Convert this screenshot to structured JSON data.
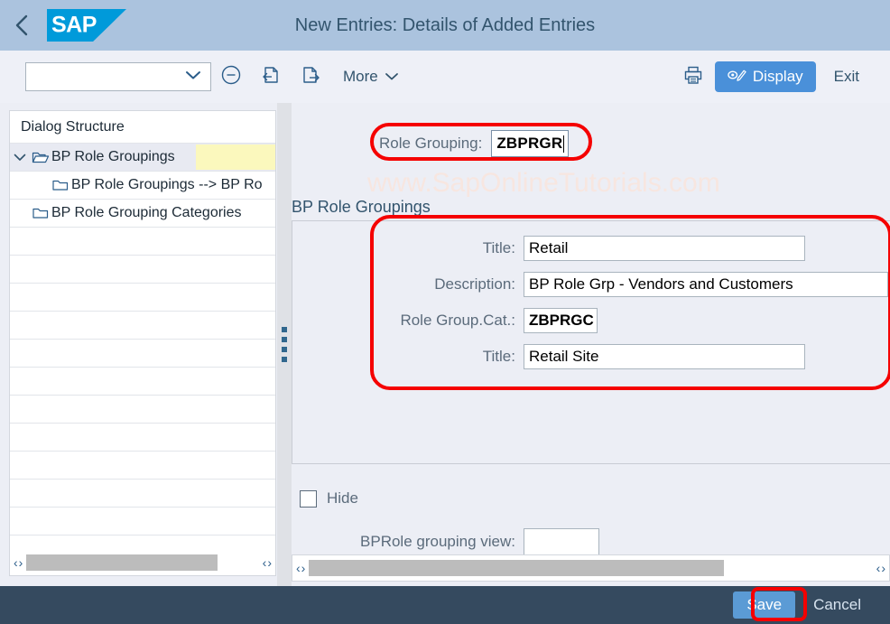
{
  "header": {
    "title": "New Entries: Details of Added Entries",
    "back_icon": "chevron-left-icon",
    "logo_text": "SAP"
  },
  "toolbar": {
    "select_value": "",
    "select_icon": "chevron-down-icon",
    "delete_icon": "minus-circle-icon",
    "prev_entry_icon": "previous-entry-icon",
    "next_entry_icon": "next-entry-icon",
    "more_label": "More",
    "more_icon": "chevron-down-icon",
    "print_icon": "printer-icon",
    "display_label": "Display",
    "display_icon": "display-change-icon",
    "exit_label": "Exit"
  },
  "sidebar": {
    "header": "Dialog Structure",
    "items": [
      {
        "label": "BP Role Groupings",
        "icon": "open-folder-icon",
        "expanded": true,
        "level": 0,
        "selected": true
      },
      {
        "label": "BP Role Groupings --> BP Ro",
        "icon": "folder-icon",
        "expanded": false,
        "level": 1,
        "selected": false
      },
      {
        "label": "BP Role Grouping Categories",
        "icon": "folder-icon",
        "expanded": false,
        "level": 0,
        "selected": false
      }
    ],
    "empty_row_count": 12,
    "scroll": {
      "left_arrow": "‹",
      "right_arrow": "›"
    }
  },
  "content": {
    "watermark": "www.SapOnlineTutorials.com",
    "role_grouping": {
      "label": "Role Grouping:",
      "value": "ZBPRGR",
      "focused": true
    },
    "section_title": "BP Role Groupings",
    "fields": [
      {
        "label": "Title:",
        "value": "Retail",
        "name": "title-field",
        "bold": false
      },
      {
        "label": "Description:",
        "value": "BP Role Grp - Vendors and Customers",
        "name": "description-field",
        "bold": false
      },
      {
        "label": "Role Group.Cat.:",
        "value": "ZBPRGC",
        "name": "role-group-cat-field",
        "bold": true
      },
      {
        "label": "Title:",
        "value": "Retail Site",
        "name": "category-title-field",
        "bold": false
      }
    ],
    "hide": {
      "label": "Hide",
      "checked": false
    },
    "bprole_grouping_view": {
      "label": "BPRole grouping view:",
      "value": ""
    },
    "scroll": {
      "left_arrow": "‹",
      "right_arrow": "›"
    }
  },
  "footer": {
    "save_label": "Save",
    "cancel_label": "Cancel"
  },
  "colors": {
    "header_bg": "#abc3de",
    "sap_blue": "#009ada",
    "accent_button": "#4a90d9",
    "footer_bg": "#354a5f",
    "annotation_red": "#f50000",
    "tree_highlight_yellow": "#fbf8bd"
  }
}
